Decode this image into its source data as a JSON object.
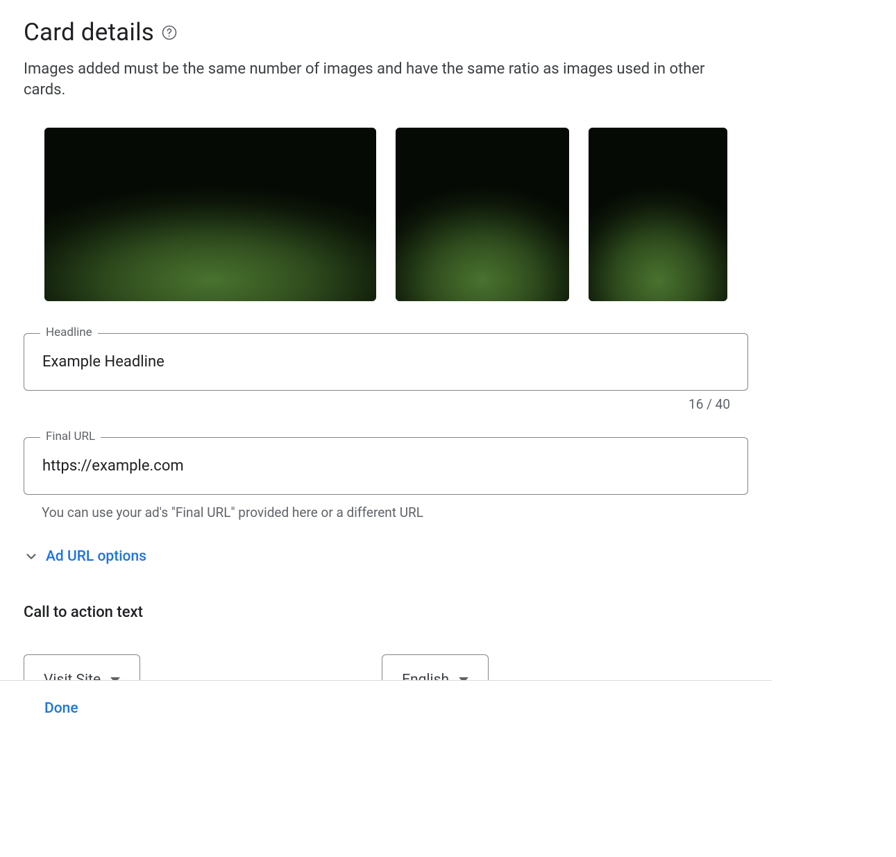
{
  "page": {
    "title": "Card details",
    "subtitle": "Images added must be the same number of images and have the same ratio as images used in other cards."
  },
  "headline": {
    "label": "Headline",
    "value": "Example Headline",
    "counter": "16 / 40"
  },
  "final_url": {
    "label": "Final URL",
    "value": "https://example.com",
    "helper": "You can use your ad's \"Final URL\" provided here or a different URL"
  },
  "ad_url_options": {
    "label": "Ad URL options"
  },
  "cta": {
    "heading": "Call to action text",
    "action_value": "Visit Site",
    "language_value": "English"
  },
  "footer": {
    "done": "Done"
  }
}
